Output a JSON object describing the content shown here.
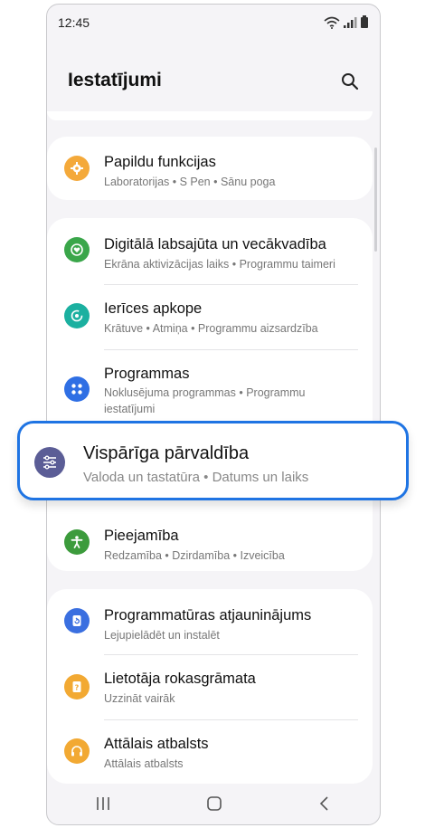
{
  "status": {
    "time": "12:45"
  },
  "header": {
    "title": "Iestatījumi",
    "search_icon": "search-icon"
  },
  "items": [
    {
      "title": "Papildu funkcijas",
      "sub": "Laboratorijas  •  S Pen  •  Sānu poga",
      "icon": "puzzle-gear-icon",
      "color": "#f4a93a"
    },
    {
      "title": "Digitālā labsajūta un vecākvadība",
      "sub": "Ekrāna aktivizācijas laiks  •  Programmu taimeri",
      "icon": "heart-circle-icon",
      "color": "#3aa64a"
    },
    {
      "title": "Ierīces apkope",
      "sub": "Krātuve  •  Atmiņa  •  Programmu aizsardzība",
      "icon": "refresh-circle-icon",
      "color": "#1bb0a0"
    },
    {
      "title": "Programmas",
      "sub": "Noklusējuma programmas  •  Programmu iestatījumi",
      "icon": "apps-grid-icon",
      "color": "#2f6fe4"
    },
    {
      "title": "Pieejamība",
      "sub": "Redzamība  •  Dzirdamība  •  Izveicība",
      "icon": "accessibility-icon",
      "color": "#3c9b3c"
    },
    {
      "title": "Programmatūras atjauninājums",
      "sub": "Lejupielādēt un instalēt",
      "icon": "update-icon",
      "color": "#3a6fe0"
    },
    {
      "title": "Lietotāja rokasgrāmata",
      "sub": "Uzzināt vairāk",
      "icon": "manual-icon",
      "color": "#f2a933"
    },
    {
      "title": "Attālais atbalsts",
      "sub": "Attālais atbalsts",
      "icon": "headset-icon",
      "color": "#f2a933"
    }
  ],
  "highlight": {
    "title": "Vispārīga pārvaldība",
    "sub": "Valoda un tastatūra  •  Datums un laiks",
    "icon": "sliders-icon",
    "color": "#5b5d96"
  },
  "nav": {
    "recents": "recents-icon",
    "home": "home-icon",
    "back": "back-icon"
  }
}
